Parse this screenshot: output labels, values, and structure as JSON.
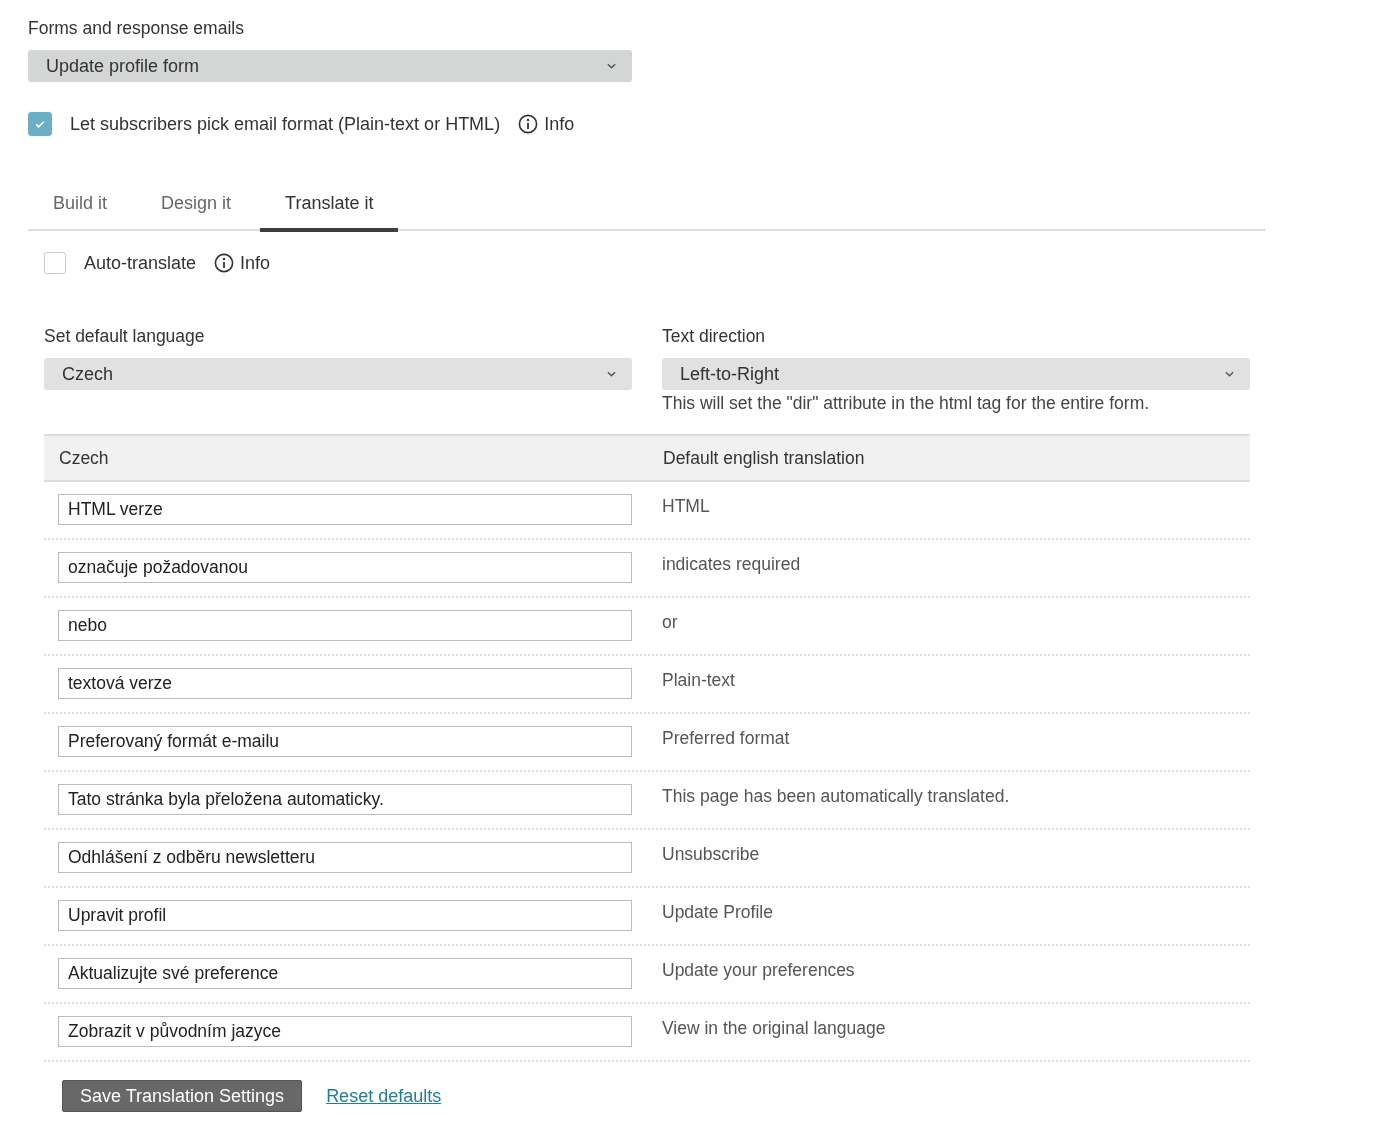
{
  "form_select": {
    "label": "Forms and response emails",
    "value": "Update profile form"
  },
  "format_option": {
    "label": "Let subscribers pick email format (Plain-text or HTML)",
    "checked": true,
    "info": "Info"
  },
  "tabs": [
    {
      "label": "Build it",
      "selected": false
    },
    {
      "label": "Design it",
      "selected": false
    },
    {
      "label": "Translate it",
      "selected": true
    }
  ],
  "auto_translate": {
    "label": "Auto-translate",
    "checked": false,
    "info": "Info"
  },
  "language_select": {
    "label": "Set default language",
    "value": "Czech"
  },
  "direction_select": {
    "label": "Text direction",
    "value": "Left-to-Right",
    "hint": "This will set the \"dir\" attribute in the html tag for the entire form."
  },
  "table": {
    "columns": [
      "Czech",
      "Default english translation"
    ],
    "rows": [
      {
        "value": "HTML verze",
        "default": "HTML"
      },
      {
        "value": "označuje požadovanou",
        "default": "indicates required"
      },
      {
        "value": "nebo",
        "default": "or"
      },
      {
        "value": "textová verze",
        "default": "Plain-text"
      },
      {
        "value": "Preferovaný formát e-mailu",
        "default": "Preferred format"
      },
      {
        "value": "Tato stránka byla přeložena automaticky.",
        "default": "This page has been automatically translated."
      },
      {
        "value": "Odhlášení z odběru newsletteru",
        "default": "Unsubscribe"
      },
      {
        "value": "Upravit profil",
        "default": "Update Profile"
      },
      {
        "value": "Aktualizujte své preference",
        "default": "Update your preferences"
      },
      {
        "value": "Zobrazit v původním jazyce",
        "default": "View in the original language"
      }
    ]
  },
  "buttons": {
    "save": "Save Translation Settings",
    "reset": "Reset defaults"
  }
}
